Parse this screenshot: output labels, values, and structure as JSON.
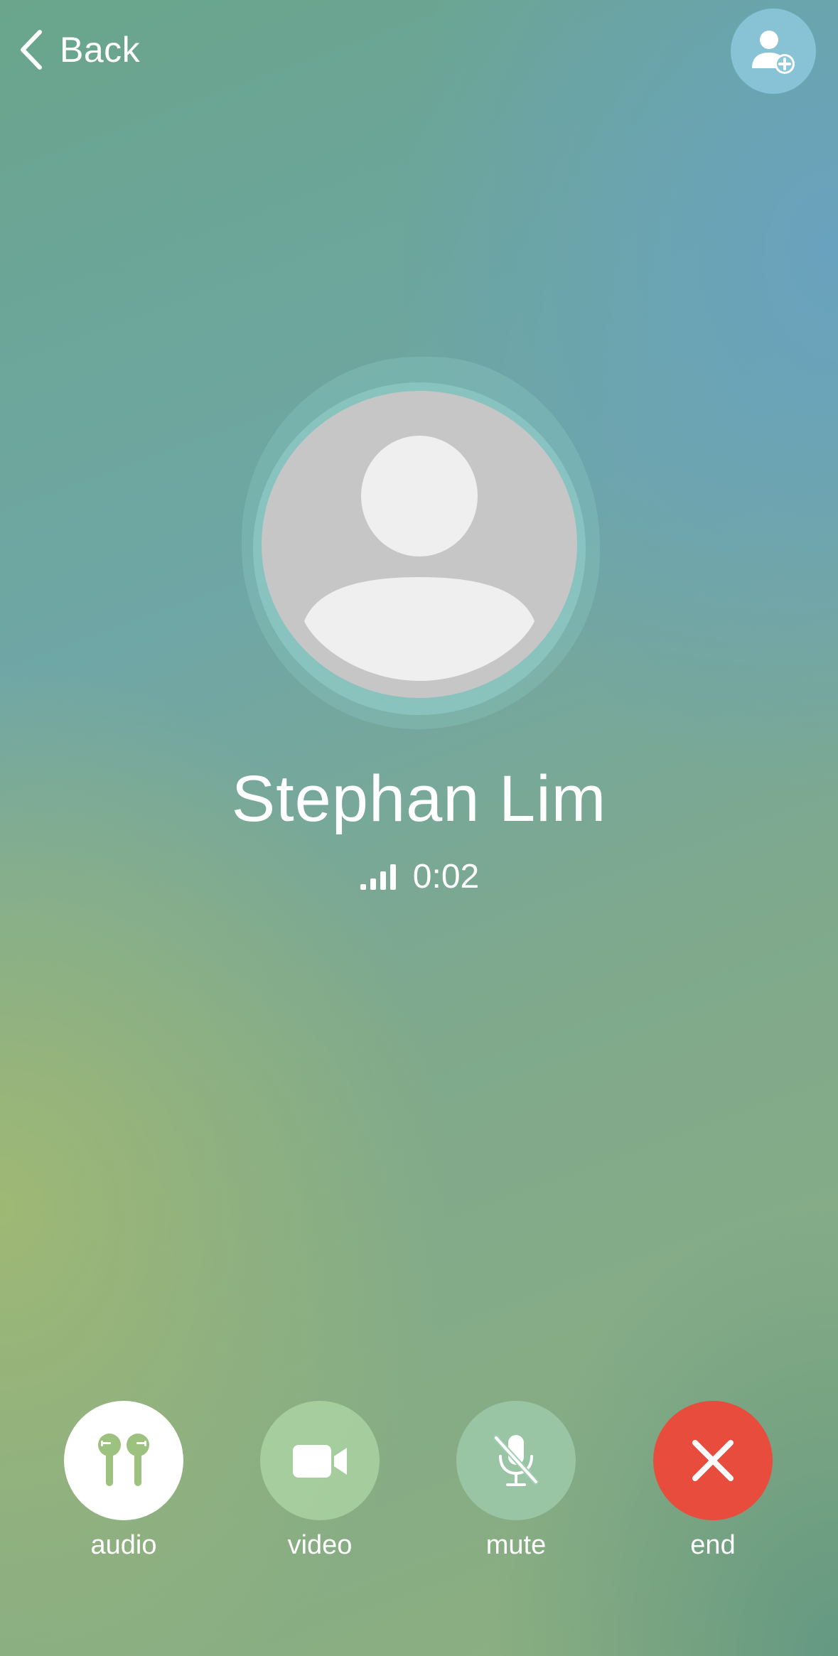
{
  "nav": {
    "back_label": "Back"
  },
  "caller": {
    "name": "Stephan Lim",
    "duration": "0:02",
    "signal_bars": 4
  },
  "controls": [
    {
      "id": "audio",
      "label": "audio",
      "icon": "airpods-icon"
    },
    {
      "id": "video",
      "label": "video",
      "icon": "video-camera-icon"
    },
    {
      "id": "mute",
      "label": "mute",
      "icon": "mic-slash-icon"
    },
    {
      "id": "end",
      "label": "end",
      "icon": "close-icon"
    }
  ],
  "colors": {
    "end_call": "#e84c3d",
    "text": "#ffffff",
    "avatar_bg": "#c6c6c6",
    "avatar_figure": "#efefef"
  }
}
